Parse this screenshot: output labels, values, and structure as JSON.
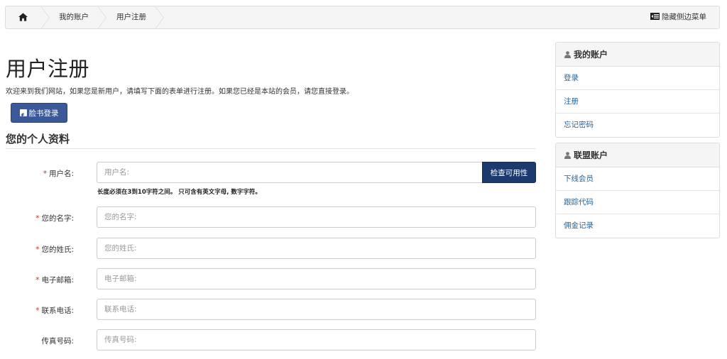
{
  "breadcrumb": {
    "home_icon": "home-icon",
    "items": [
      "我的账户",
      "用户注册"
    ],
    "hide_sidebar_label": "隐藏侧边菜单"
  },
  "main": {
    "title": "用户注册",
    "intro": "欢迎来到我们网站，如果您是新用户，请填写下面的表单进行注册。如果您已经是本站的会员，请您直接登录。",
    "facebook_button": "脸书登录",
    "section_title": "您的个人资料",
    "check_availability_button": "检查可用性",
    "username_help": "长度必须在3到10字符之间。 只可含有英文字母, 数字字符。",
    "fields": [
      {
        "label": "用户名:",
        "placeholder": "用户名:",
        "value": "",
        "required": true
      },
      {
        "label": "您的名字:",
        "placeholder": "您的名字:",
        "value": "",
        "required": true
      },
      {
        "label": "您的姓氏:",
        "placeholder": "您的姓氏:",
        "value": "",
        "required": true
      },
      {
        "label": "电子邮箱:",
        "placeholder": "电子邮箱:",
        "value": "",
        "required": true
      },
      {
        "label": "联系电话:",
        "placeholder": "联系电话:",
        "value": "",
        "required": true
      },
      {
        "label": "传真号码:",
        "placeholder": "传真号码:",
        "value": "",
        "required": false
      }
    ],
    "required_mark": "*"
  },
  "sidebar": {
    "panels": [
      {
        "title": "我的账户",
        "icon": "user-icon",
        "items": [
          "登录",
          "注册",
          "忘记密码"
        ]
      },
      {
        "title": "联盟账户",
        "icon": "user-icon",
        "items": [
          "下线会员",
          "跟踪代码",
          "佣金记录"
        ]
      }
    ]
  },
  "colors": {
    "facebook_blue": "#3b5998",
    "check_button": "#1c3a6d",
    "link": "#2a6496",
    "required": "#c0392b"
  }
}
